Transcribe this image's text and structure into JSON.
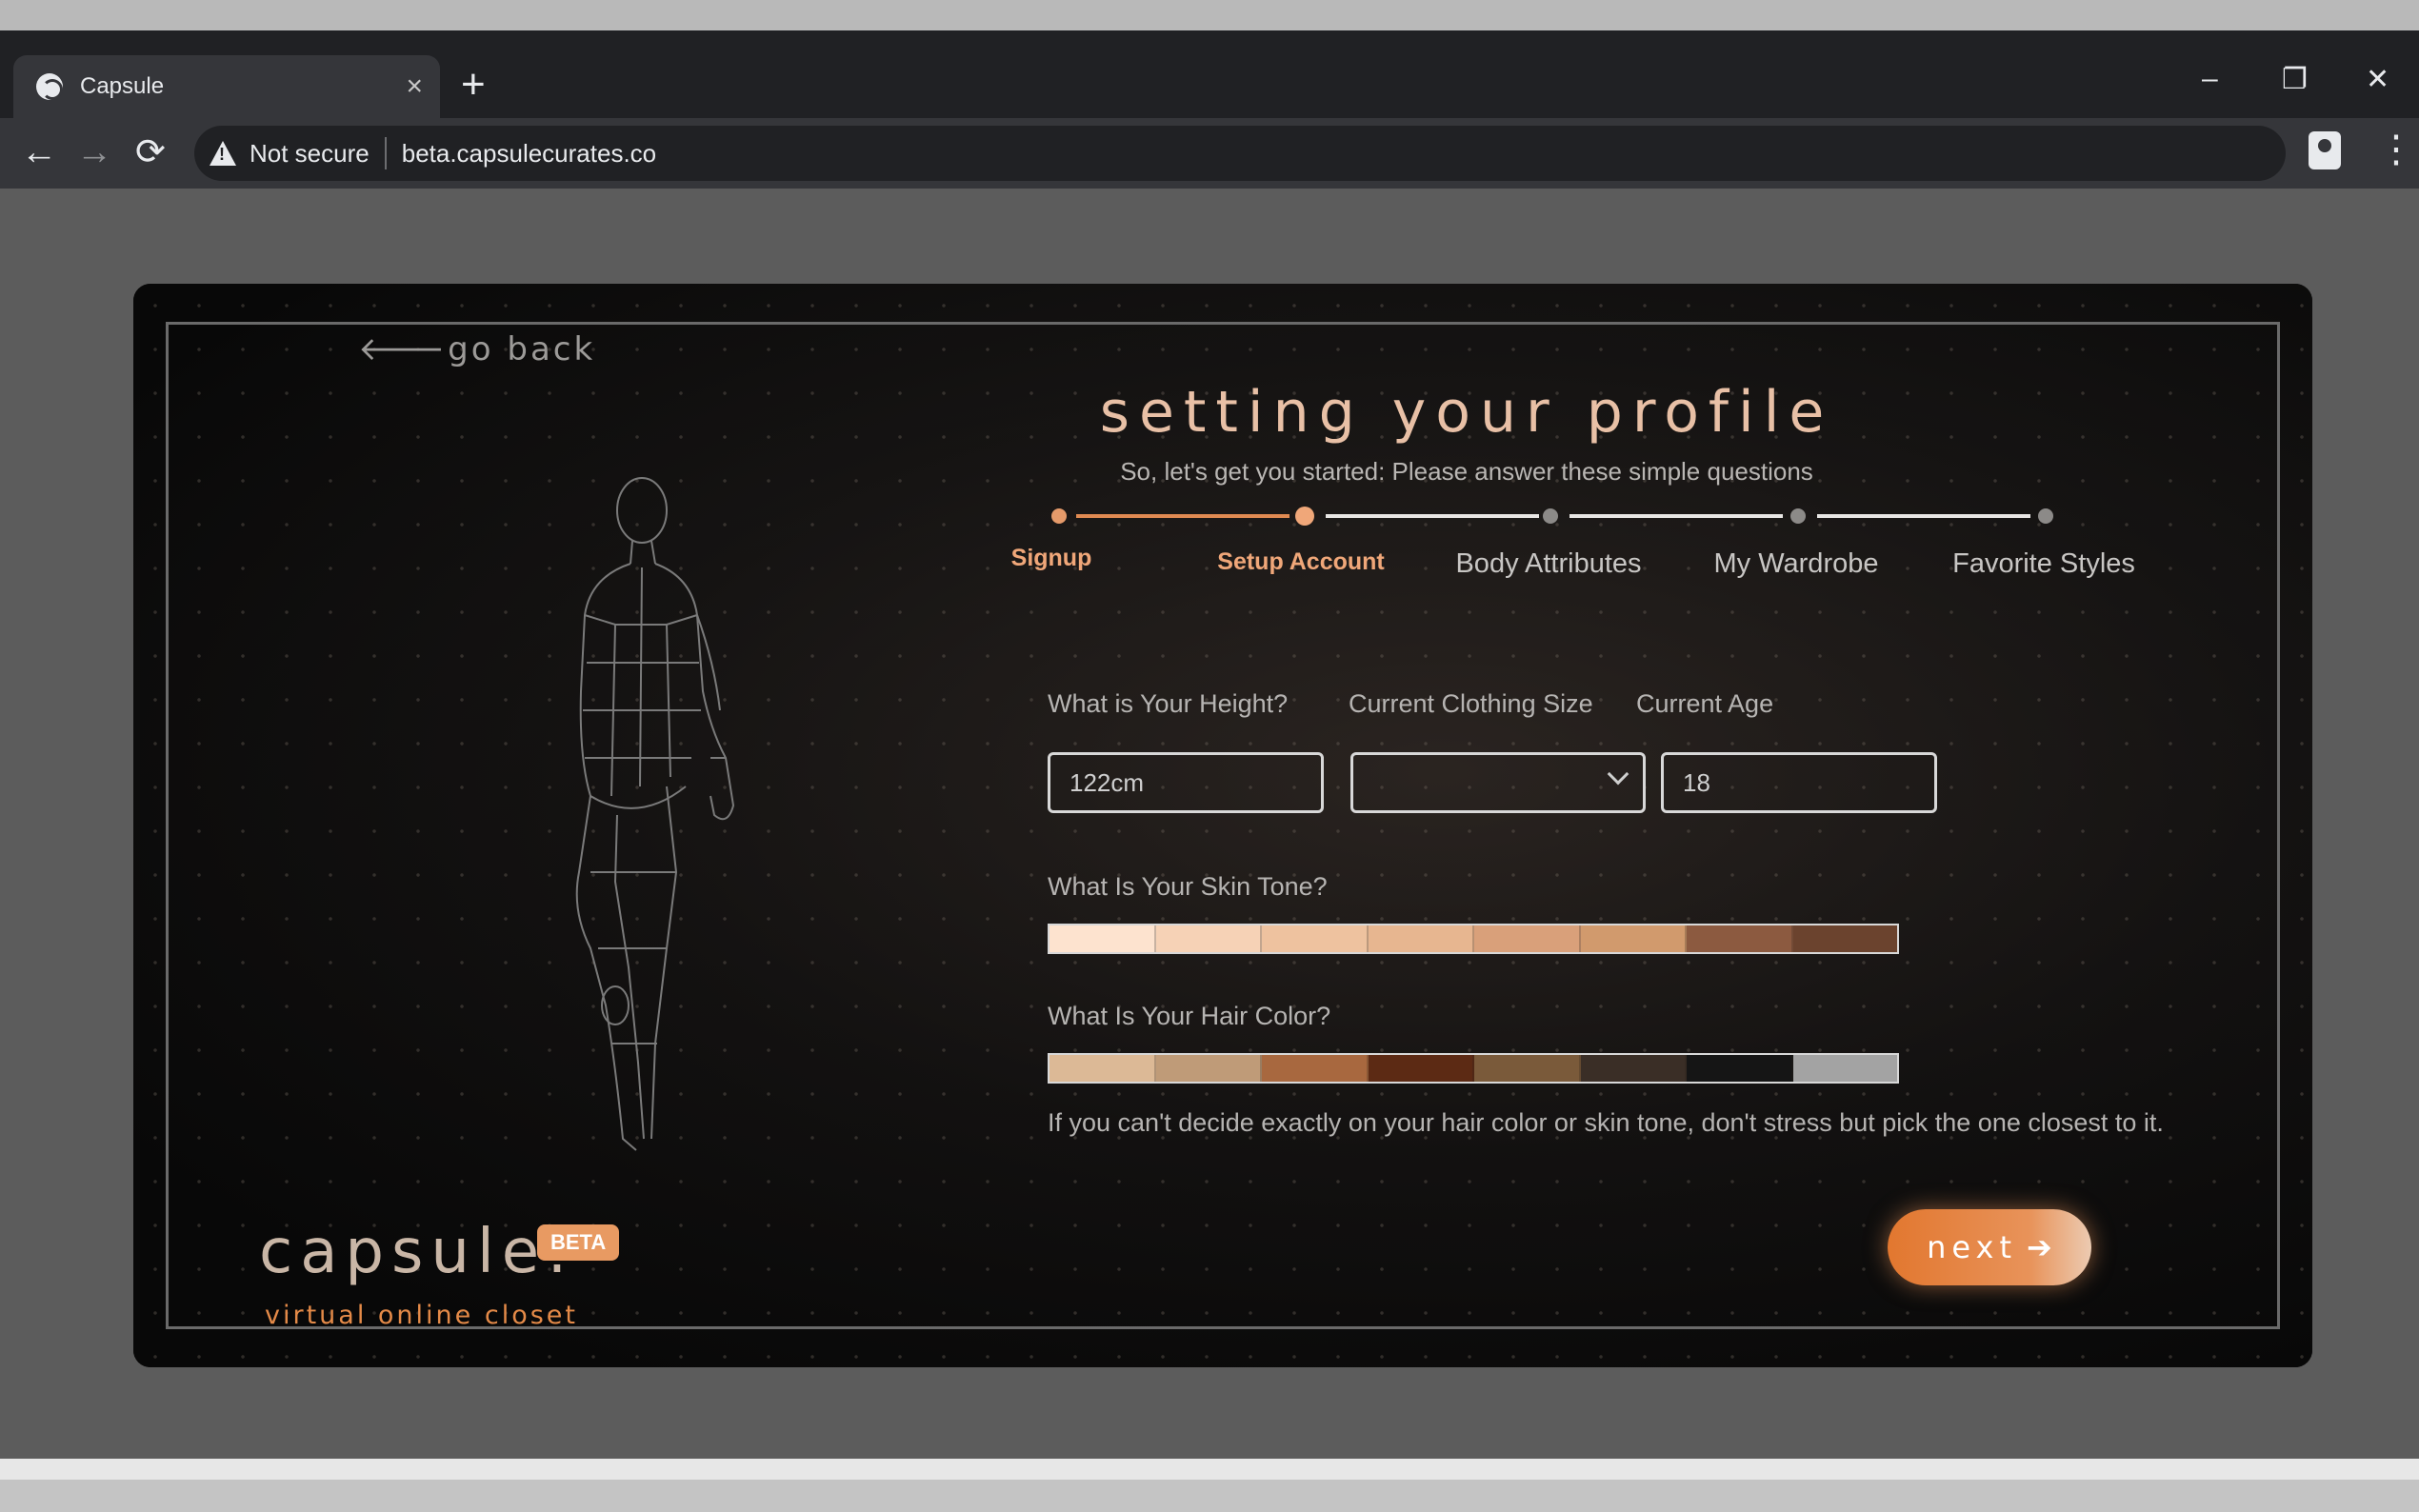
{
  "browser": {
    "tab_title": "Capsule",
    "tab_close": "×",
    "new_tab": "+",
    "minimize": "–",
    "restore": "❐",
    "close": "✕",
    "back": "←",
    "forward": "→",
    "reload": "⟳",
    "security_label": "Not secure",
    "url": "beta.capsulecurates.co",
    "menu": "⋮"
  },
  "app": {
    "go_back": "🡐go back",
    "title": "setting your profile",
    "subtitle": "So, let's get you started: Please answer these simple questions",
    "steps": [
      {
        "label": "Signup",
        "state": "done"
      },
      {
        "label": "Setup Account",
        "state": "current"
      },
      {
        "label": "Body Attributes",
        "state": "pending"
      },
      {
        "label": "My Wardrobe",
        "state": "pending"
      },
      {
        "label": "Favorite Styles",
        "state": "pending"
      }
    ],
    "form": {
      "height_label": "What is Your Height?",
      "height_value": "122cm",
      "size_label": "Current Clothing Size",
      "size_value": "",
      "age_label": "Current Age",
      "age_value": "18",
      "skin_label": "What Is Your Skin Tone?",
      "skin_colors": [
        "#fde3cf",
        "#f6d2b6",
        "#eec29f",
        "#e7b690",
        "#d9a07a",
        "#d19a6d",
        "#8c5a40",
        "#6b432e"
      ],
      "hair_label": "What Is Your Hair Color?",
      "hair_colors": [
        "#dcb996",
        "#bf9b78",
        "#a8683f",
        "#5c2a14",
        "#7a5a3a",
        "#3a2e26",
        "#151515",
        "#a3a3a3"
      ],
      "hint": "If you can't decide exactly on your hair color or skin tone, don't stress but pick the one closest to it."
    },
    "logo": {
      "word": "capsule:",
      "badge": "BETA",
      "tagline": "virtual online closet"
    },
    "next_label": "next",
    "next_arrow": "➔"
  }
}
